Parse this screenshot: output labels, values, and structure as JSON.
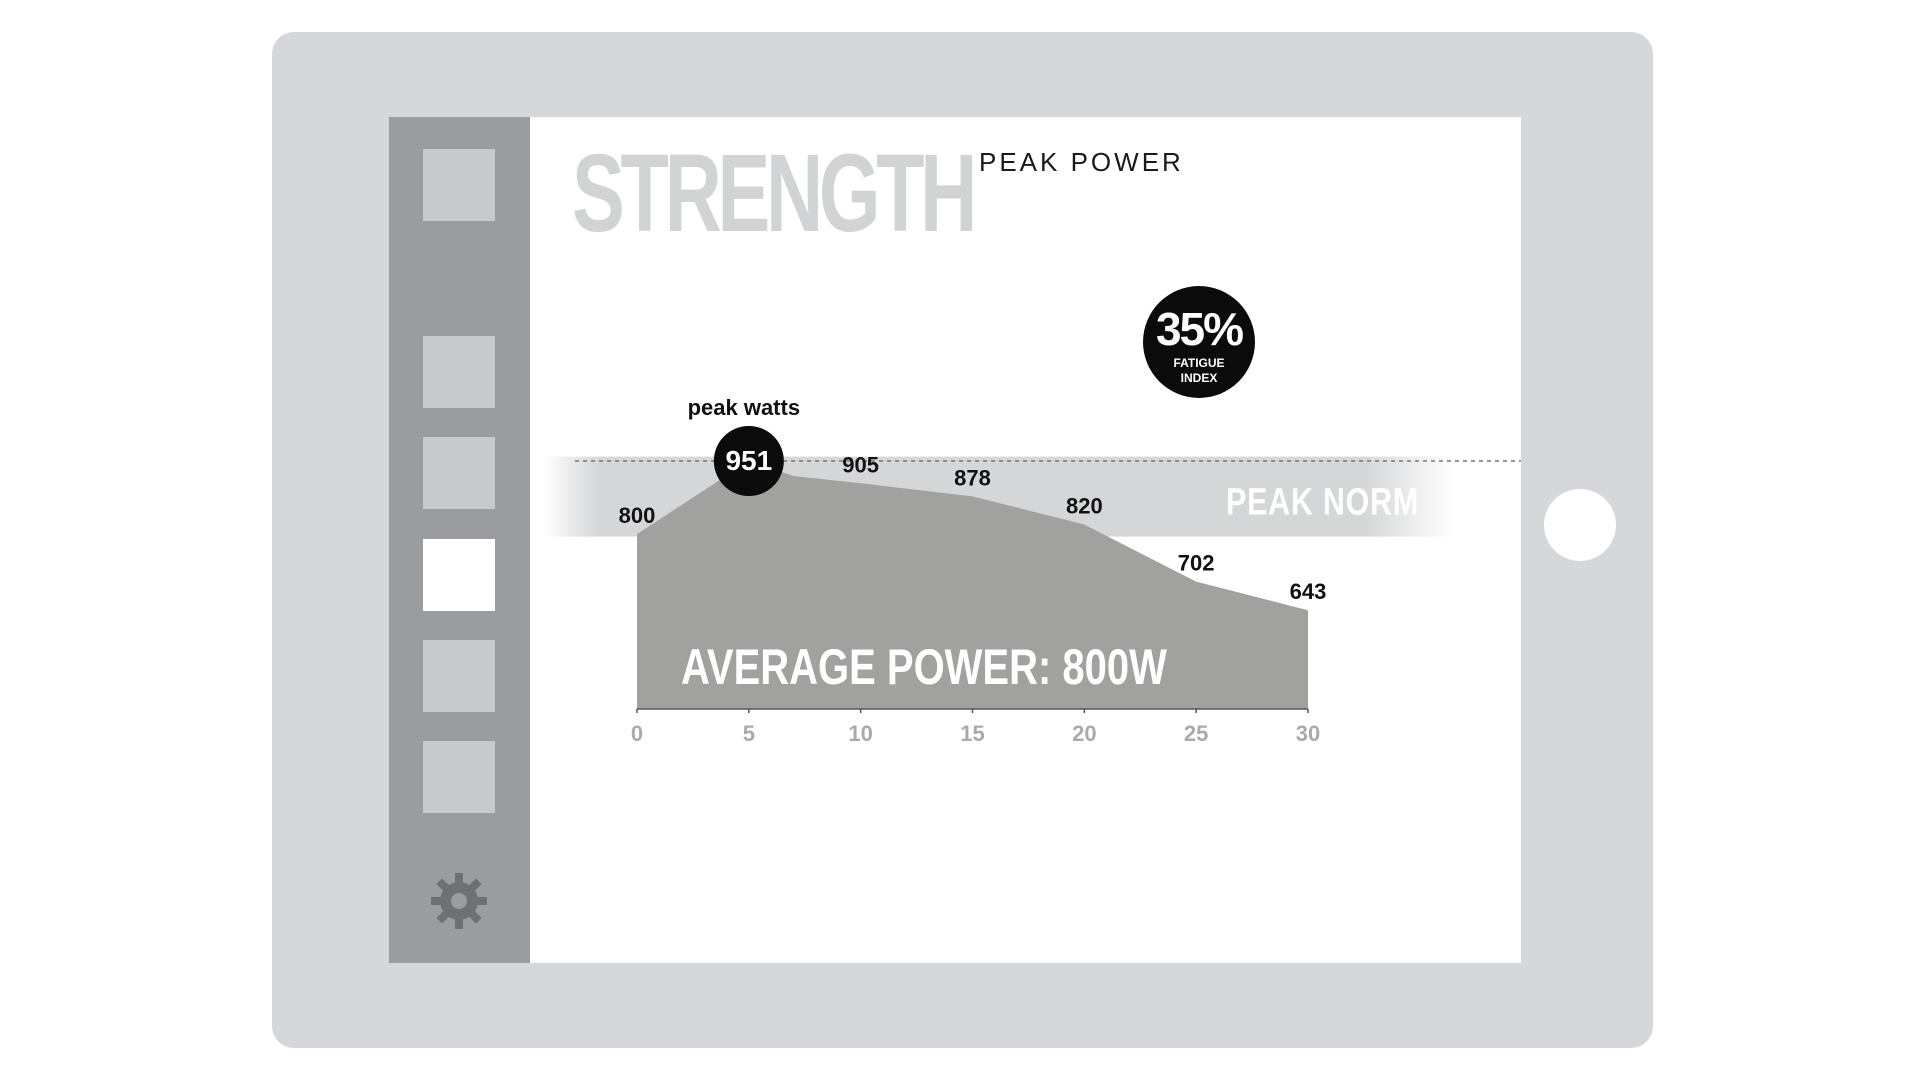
{
  "header": {
    "title": "STRENGTH",
    "subtitle": "PEAK POWER"
  },
  "fatigue": {
    "value": "35%",
    "label": "FATIGUE INDEX"
  },
  "sidebar": {
    "items": [
      {
        "id": "nav-1",
        "active": false
      },
      {
        "id": "nav-2",
        "active": false
      },
      {
        "id": "nav-3",
        "active": false
      },
      {
        "id": "nav-4",
        "active": true
      },
      {
        "id": "nav-5",
        "active": false
      },
      {
        "id": "nav-6",
        "active": false
      }
    ],
    "settings_icon": "gear-icon"
  },
  "colors": {
    "sidebar": "#9b9ca0",
    "tile": "#c8c9cc",
    "band": "#d5d6d8",
    "area": "#a1a1a0",
    "title": "#d2d3d5",
    "dark": "#0b0b0b"
  },
  "chart_data": {
    "type": "area",
    "x": [
      0,
      5,
      7,
      10,
      15,
      20,
      25,
      30
    ],
    "y": [
      800,
      951,
      920,
      905,
      878,
      820,
      702,
      643
    ],
    "point_labels": [
      {
        "x": 0,
        "y": 800,
        "label": "800"
      },
      {
        "x": 5,
        "y": 951,
        "label": "951",
        "highlight": true
      },
      {
        "x": 10,
        "y": 905,
        "label": "905"
      },
      {
        "x": 15,
        "y": 878,
        "label": "878"
      },
      {
        "x": 20,
        "y": 820,
        "label": "820"
      },
      {
        "x": 25,
        "y": 702,
        "label": "702"
      },
      {
        "x": 30,
        "y": 643,
        "label": "643"
      }
    ],
    "xticks": [
      "0",
      "5",
      "10",
      "15",
      "20",
      "25",
      "30"
    ],
    "xlim": [
      0,
      30
    ],
    "ylim": [
      400,
      960
    ],
    "peak_annotation": "peak watts",
    "band_label": "PEAK NORM",
    "band_range": [
      795,
      960
    ],
    "peak_line": 951,
    "area_label": "AVERAGE POWER: 800W",
    "grid": false
  }
}
